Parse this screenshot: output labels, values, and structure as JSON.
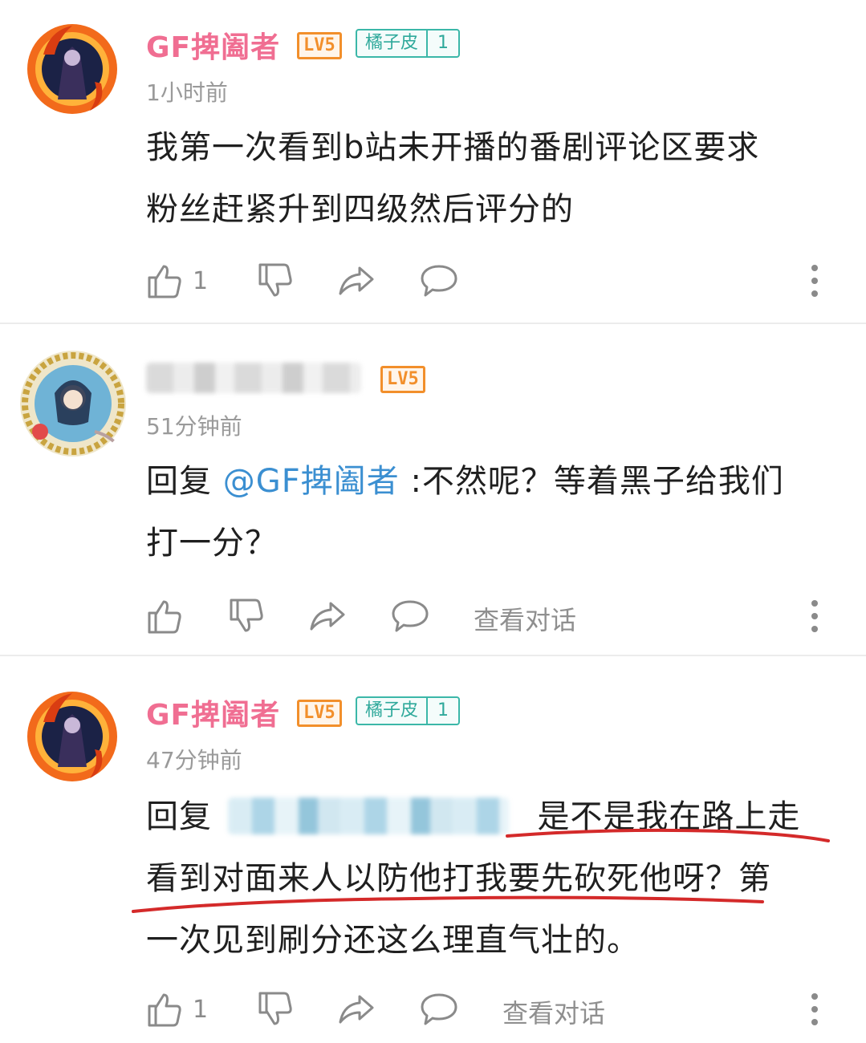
{
  "comments": [
    {
      "username": "GF捭阖者",
      "level": "LV5",
      "fan_badge": {
        "name": "橘子皮",
        "level": "1"
      },
      "time": "1小时前",
      "text_lines": [
        "我第一次看到b站未开播的番剧评论区要求",
        "粉丝赶紧升到四级然后评分的"
      ],
      "likes": "1"
    },
    {
      "username_blurred": true,
      "level": "LV5",
      "time": "51分钟前",
      "reply_prefix": "回复",
      "mention": "@GF捭阖者",
      "reply_text_1": ":不然呢？等着黑子给我们",
      "reply_text_2": "打一分？",
      "view_conversation": "查看对话"
    },
    {
      "username": "GF捭阖者",
      "level": "LV5",
      "fan_badge": {
        "name": "橘子皮",
        "level": "1"
      },
      "time": "47分钟前",
      "reply_prefix": "回复",
      "mention_blurred": true,
      "line1_rest": "是不是我在路上走",
      "line2": "看到对面来人以防他打我要先砍死他呀？第",
      "line3": "一次见到刷分还这么理直气壮的。",
      "likes": "1",
      "view_conversation": "查看对话"
    }
  ],
  "icons": [
    "thumb-up-icon",
    "thumb-down-icon",
    "share-icon",
    "reply-bubble-icon",
    "more-vertical-icon"
  ],
  "colors": {
    "username": "#f06e92",
    "level": "#f28f2b",
    "fan_badge": "#3bb7a8",
    "mention": "#3b8fd1",
    "annotation": "#d42a2a",
    "muted": "#9a9a9a"
  }
}
